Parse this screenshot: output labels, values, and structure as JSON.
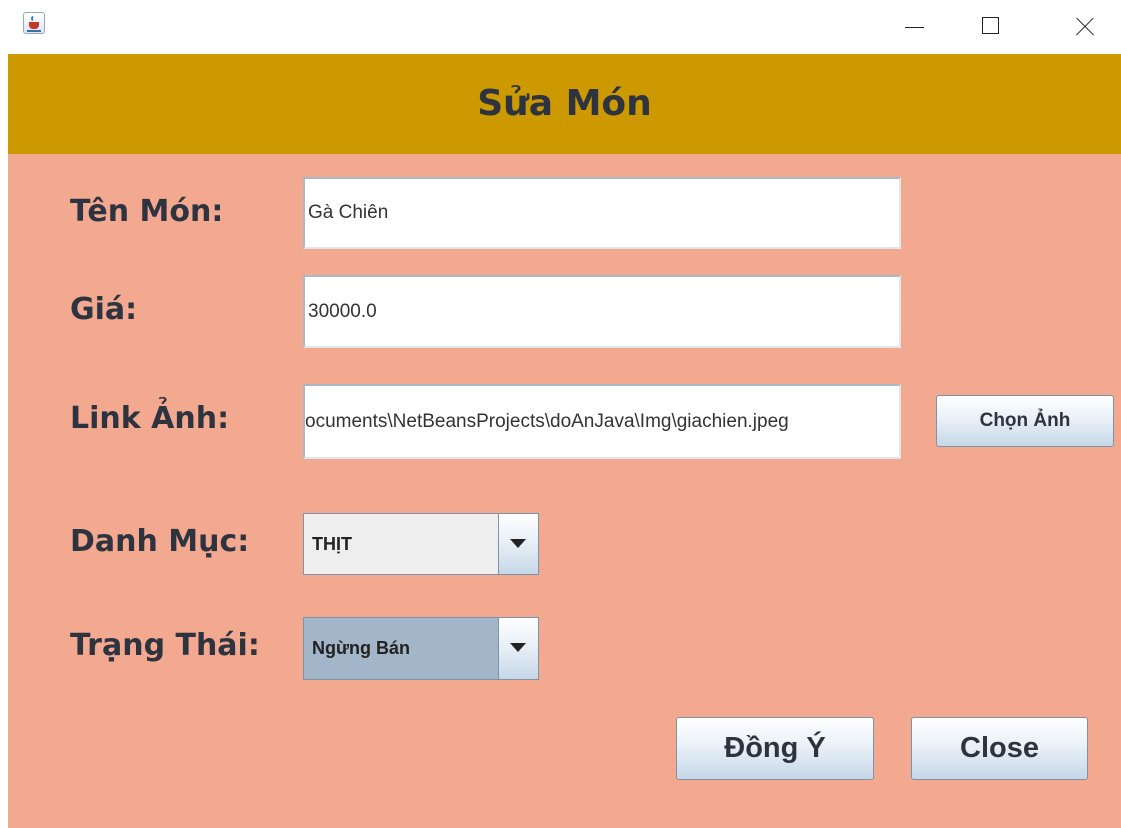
{
  "window": {
    "controls": {
      "minimize_icon": "minimize-icon",
      "maximize_icon": "maximize-icon",
      "close_icon": "close-icon"
    },
    "app_icon": "java-cup-icon"
  },
  "header": {
    "title": "Sửa Món",
    "background": "#cc9900"
  },
  "form": {
    "background": "#f2a98f",
    "name_label": "Tên Món:",
    "name_value": "Gà Chiên",
    "price_label": "Giá:",
    "price_value": "30000.0",
    "image_label": "Link Ảnh:",
    "image_value": "ocuments\\NetBeansProjects\\doAnJava\\Img\\giachien.jpeg",
    "choose_image_button": "Chọn Ảnh",
    "category_label": "Danh Mục:",
    "category_value": "THỊT",
    "status_label": "Trạng Thái:",
    "status_value": "Ngừng Bán"
  },
  "actions": {
    "ok_button": "Đồng Ý",
    "close_button": "Close"
  }
}
